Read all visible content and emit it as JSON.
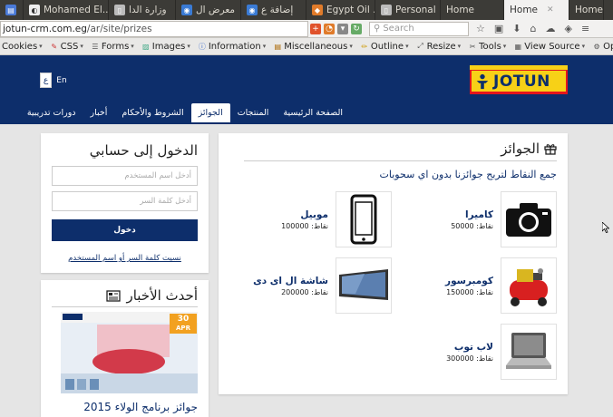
{
  "browser": {
    "tabs": [
      {
        "label": "Mohamed El...",
        "active": false
      },
      {
        "label": "وزارة الدا",
        "active": false
      },
      {
        "label": "معرض ال",
        "active": false
      },
      {
        "label": "إضافة ع",
        "active": false
      },
      {
        "label": "Egypt Oil ...",
        "active": false
      },
      {
        "label": "Personal ...",
        "active": false
      },
      {
        "label": "Home",
        "active": false
      },
      {
        "label": "Home",
        "active": true
      },
      {
        "label": "Home",
        "active": false
      }
    ],
    "url_host": "jotun-crm.com.eg",
    "url_path": "/ar/site/prizes",
    "search_placeholder": "Search"
  },
  "devtoolbar": {
    "items": [
      "Cookies",
      "CSS",
      "Forms",
      "Images",
      "Information",
      "Miscellaneous",
      "Outline",
      "Resize",
      "Tools",
      "View Source",
      "Options"
    ]
  },
  "site": {
    "lang_ar": "ع",
    "lang_en": "En",
    "logo_text": "JOTUN",
    "nav": [
      {
        "label": "الصفحة الرئيسية",
        "active": false
      },
      {
        "label": "المنتجات",
        "active": false
      },
      {
        "label": "الجوائز",
        "active": true
      },
      {
        "label": "الشروط والأحكام",
        "active": false
      },
      {
        "label": "أخبار",
        "active": false
      },
      {
        "label": "دورات تدريبية",
        "active": false
      }
    ]
  },
  "login": {
    "title": "الدخول إلى حسابي",
    "username_placeholder": "أدخل اسم المستخدم",
    "password_placeholder": "أدخل كلمة السر",
    "submit_label": "دخول",
    "forgot_link": "نسيت كلمة السر أو اسم المستخدم"
  },
  "news": {
    "title": "أحدث الأخبار",
    "badge_day": "30",
    "badge_month": "APR",
    "headline": "جوائز برنامج الولاء 2015"
  },
  "prizes": {
    "title": "الجوائز",
    "subtitle": "جمع النقاط لتربح جوائزنا بدون اي سحوبات",
    "items": [
      {
        "name": "كاميرا",
        "points": "نقاط: 50000",
        "icon": "camera-icon"
      },
      {
        "name": "موبيل",
        "points": "نقاط: 100000",
        "icon": "mobile-phone-icon"
      },
      {
        "name": "كومبرسور",
        "points": "نقاط: 150000",
        "icon": "compressor-icon"
      },
      {
        "name": "شاشة ال اى دى",
        "points": "نقاط: 200000",
        "icon": "led-tv-icon"
      },
      {
        "name": "لاب توب",
        "points": "نقاط: 300000",
        "icon": "laptop-icon"
      }
    ]
  },
  "colors": {
    "brand_navy": "#0d2e6b",
    "brand_red": "#e4161c",
    "brand_yellow": "#f7d117"
  }
}
